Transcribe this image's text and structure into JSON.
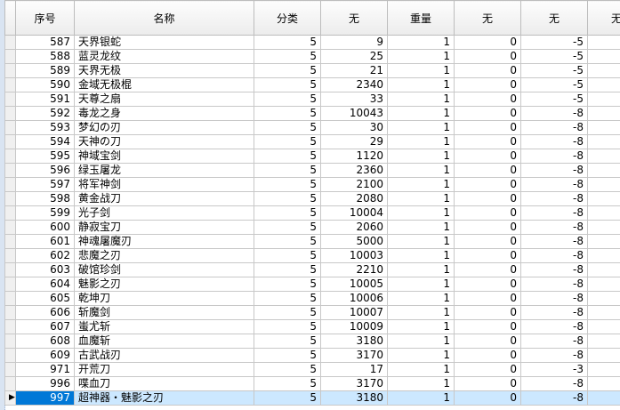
{
  "columns": [
    "序号",
    "名称",
    "分类",
    "无",
    "重量",
    "无",
    "无",
    "无"
  ],
  "current_row_marker": "▶",
  "rows": [
    {
      "id": "587",
      "name": "天界银蛇",
      "cat": "5",
      "v1": "9",
      "weight": "1",
      "v2": "0",
      "v3": "-5",
      "selected": false
    },
    {
      "id": "588",
      "name": "蓝灵龙纹",
      "cat": "5",
      "v1": "25",
      "weight": "1",
      "v2": "0",
      "v3": "-5",
      "selected": false
    },
    {
      "id": "589",
      "name": "天界无极",
      "cat": "5",
      "v1": "21",
      "weight": "1",
      "v2": "0",
      "v3": "-5",
      "selected": false
    },
    {
      "id": "590",
      "name": "金域无极棍",
      "cat": "5",
      "v1": "2340",
      "weight": "1",
      "v2": "0",
      "v3": "-5",
      "selected": false
    },
    {
      "id": "591",
      "name": "天尊之扇",
      "cat": "5",
      "v1": "33",
      "weight": "1",
      "v2": "0",
      "v3": "-5",
      "selected": false
    },
    {
      "id": "592",
      "name": "毒龙之身",
      "cat": "5",
      "v1": "10043",
      "weight": "1",
      "v2": "0",
      "v3": "-8",
      "selected": false
    },
    {
      "id": "593",
      "name": "梦幻の刃",
      "cat": "5",
      "v1": "30",
      "weight": "1",
      "v2": "0",
      "v3": "-8",
      "selected": false
    },
    {
      "id": "594",
      "name": "天神の刀",
      "cat": "5",
      "v1": "29",
      "weight": "1",
      "v2": "0",
      "v3": "-8",
      "selected": false
    },
    {
      "id": "595",
      "name": "神域宝剑",
      "cat": "5",
      "v1": "1120",
      "weight": "1",
      "v2": "0",
      "v3": "-8",
      "selected": false
    },
    {
      "id": "596",
      "name": "绿玉屠龙",
      "cat": "5",
      "v1": "2360",
      "weight": "1",
      "v2": "0",
      "v3": "-8",
      "selected": false
    },
    {
      "id": "597",
      "name": "将军神剑",
      "cat": "5",
      "v1": "2100",
      "weight": "1",
      "v2": "0",
      "v3": "-8",
      "selected": false
    },
    {
      "id": "598",
      "name": "黄金战刀",
      "cat": "5",
      "v1": "2080",
      "weight": "1",
      "v2": "0",
      "v3": "-8",
      "selected": false
    },
    {
      "id": "599",
      "name": "光子剑",
      "cat": "5",
      "v1": "10004",
      "weight": "1",
      "v2": "0",
      "v3": "-8",
      "selected": false
    },
    {
      "id": "600",
      "name": "静寂宝刀",
      "cat": "5",
      "v1": "2060",
      "weight": "1",
      "v2": "0",
      "v3": "-8",
      "selected": false
    },
    {
      "id": "601",
      "name": "神魂屠魔刃",
      "cat": "5",
      "v1": "5000",
      "weight": "1",
      "v2": "0",
      "v3": "-8",
      "selected": false
    },
    {
      "id": "602",
      "name": "悲魔之刃",
      "cat": "5",
      "v1": "10003",
      "weight": "1",
      "v2": "0",
      "v3": "-8",
      "selected": false
    },
    {
      "id": "603",
      "name": "破馆珍剑",
      "cat": "5",
      "v1": "2210",
      "weight": "1",
      "v2": "0",
      "v3": "-8",
      "selected": false
    },
    {
      "id": "604",
      "name": "魅影之刃",
      "cat": "5",
      "v1": "10005",
      "weight": "1",
      "v2": "0",
      "v3": "-8",
      "selected": false
    },
    {
      "id": "605",
      "name": "乾坤刀",
      "cat": "5",
      "v1": "10006",
      "weight": "1",
      "v2": "0",
      "v3": "-8",
      "selected": false
    },
    {
      "id": "606",
      "name": "斩魔剑",
      "cat": "5",
      "v1": "10007",
      "weight": "1",
      "v2": "0",
      "v3": "-8",
      "selected": false
    },
    {
      "id": "607",
      "name": "蚩尤斩",
      "cat": "5",
      "v1": "10009",
      "weight": "1",
      "v2": "0",
      "v3": "-8",
      "selected": false
    },
    {
      "id": "608",
      "name": "血魔斩",
      "cat": "5",
      "v1": "3180",
      "weight": "1",
      "v2": "0",
      "v3": "-8",
      "selected": false
    },
    {
      "id": "609",
      "name": "古武战刃",
      "cat": "5",
      "v1": "3170",
      "weight": "1",
      "v2": "0",
      "v3": "-8",
      "selected": false
    },
    {
      "id": "971",
      "name": "开荒刀",
      "cat": "5",
      "v1": "17",
      "weight": "1",
      "v2": "0",
      "v3": "-3",
      "selected": false
    },
    {
      "id": "996",
      "name": "喋血刀",
      "cat": "5",
      "v1": "3170",
      "weight": "1",
      "v2": "0",
      "v3": "-8",
      "selected": false
    },
    {
      "id": "997",
      "name": "超神器・魅影之刃",
      "cat": "5",
      "v1": "3180",
      "weight": "1",
      "v2": "0",
      "v3": "-8",
      "selected": true
    }
  ]
}
